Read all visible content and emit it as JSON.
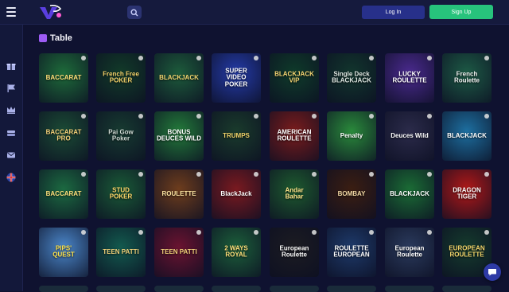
{
  "header": {
    "login_label": "Log In",
    "signup_label": "Sign Up"
  },
  "sidebar": {
    "items": [
      {
        "icon": "gift-icon"
      },
      {
        "icon": "flag-icon"
      },
      {
        "icon": "crown-icon"
      },
      {
        "icon": "layers-icon"
      },
      {
        "icon": "mail-icon"
      },
      {
        "icon": "uk-flag-icon"
      }
    ]
  },
  "section": {
    "title": "Table"
  },
  "games": [
    {
      "label": "BACCARAT",
      "bg": "#1e6b3a",
      "color": "#ffe07a"
    },
    {
      "label": "French Free\nPOKER",
      "bg": "#123b29",
      "color": "#f5d36b"
    },
    {
      "label": "BLACKJACK",
      "bg": "#1d5b3b",
      "color": "#f2d56f"
    },
    {
      "label": "SUPER\nVIDEO\nPOKER",
      "bg": "#243ba8",
      "color": "#ffffff"
    },
    {
      "label": "BLACKJACK\nVIP",
      "bg": "#0f3b2a",
      "color": "#f7d774"
    },
    {
      "label": "Single Deck\nBLACKJACK",
      "bg": "#12362d",
      "color": "#dfe7e2"
    },
    {
      "label": "LUCKY\nROULETTE",
      "bg": "#4a2a8e",
      "color": "#ffffff"
    },
    {
      "label": "French\nRoulette",
      "bg": "#1d5a45",
      "color": "#f2f2f2"
    },
    {
      "label": "BACCARAT\nPRO",
      "bg": "#1b4b35",
      "color": "#f5d27a"
    },
    {
      "label": "Pai Gow\nPoker",
      "bg": "#173b31",
      "color": "#cfd9d3"
    },
    {
      "label": "BONUS DEUCES WILD",
      "bg": "#237a3a",
      "color": "#ffffff"
    },
    {
      "label": "TRUMPS",
      "bg": "#1a3b2c",
      "color": "#f0d36a"
    },
    {
      "label": "AMERICAN\nROULETTE",
      "bg": "#7a1c1c",
      "color": "#ffffff"
    },
    {
      "label": "Penalty",
      "bg": "#2a8a3b",
      "color": "#ffffff"
    },
    {
      "label": "Deuces Wild",
      "bg": "#2b2b4a",
      "color": "#ffffff"
    },
    {
      "label": "BLACKJACK",
      "bg": "#1d6fa0",
      "color": "#ffffff"
    },
    {
      "label": "BACCARAT",
      "bg": "#1c6a41",
      "color": "#ffe27c"
    },
    {
      "label": "STUD\nPOKER",
      "bg": "#1a5a37",
      "color": "#ffd76a"
    },
    {
      "label": "ROULETTE",
      "bg": "#6e3d1d",
      "color": "#ffe7a4"
    },
    {
      "label": "BlackJack",
      "bg": "#7a1a20",
      "color": "#ffffff"
    },
    {
      "label": "Andar\nBahar",
      "bg": "#1e5a2f",
      "color": "#ffe58a"
    },
    {
      "label": "BOMBAY",
      "bg": "#3b1e12",
      "color": "#f3d9a5"
    },
    {
      "label": "BLACKJACK",
      "bg": "#1b6c35",
      "color": "#ffffff"
    },
    {
      "label": "DRAGON\nTIGER",
      "bg": "#b01818",
      "color": "#ffffff"
    },
    {
      "label": "PIPS'\nQUEST",
      "bg": "#4a86c9",
      "color": "#ffe34a"
    },
    {
      "label": "TEEN PATTI",
      "bg": "#135a4e",
      "color": "#f2d27a"
    },
    {
      "label": "TEEN PATTI",
      "bg": "#6a1330",
      "color": "#f2d27a"
    },
    {
      "label": "2 WAYS ROYAL",
      "bg": "#1c5e3a",
      "color": "#ffe07a"
    },
    {
      "label": "European\nRoulette",
      "bg": "#1c1c22",
      "color": "#ffffff"
    },
    {
      "label": "ROULETTE\nEUROPEAN",
      "bg": "#1e3a6a",
      "color": "#ffffff"
    },
    {
      "label": "European\nRoulette",
      "bg": "#2a3a5c",
      "color": "#ffffff"
    },
    {
      "label": "EUROPEAN\nROULETTE",
      "bg": "#153b2d",
      "color": "#f3d56b"
    }
  ]
}
